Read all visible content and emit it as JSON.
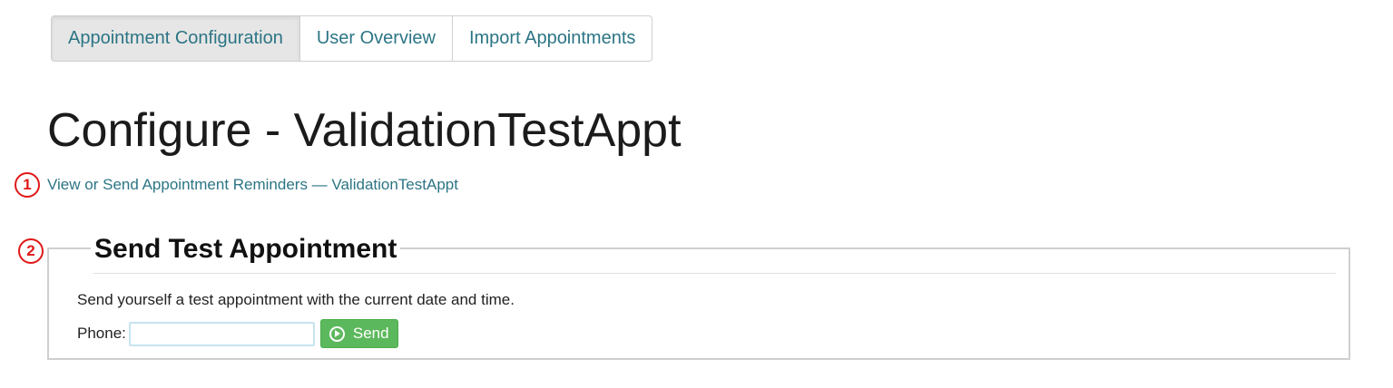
{
  "tabs": [
    {
      "label": "Appointment Configuration",
      "active": true
    },
    {
      "label": "User Overview",
      "active": false
    },
    {
      "label": "Import Appointments",
      "active": false
    }
  ],
  "page_title": "Configure - ValidationTestAppt",
  "markers": [
    "1",
    "2"
  ],
  "reminder_link": "View or Send Appointment Reminders — ValidationTestAppt",
  "send_test": {
    "legend": "Send Test Appointment",
    "description": "Send yourself a test appointment with the current date and time.",
    "phone_label": "Phone:",
    "phone_value": "",
    "send_label": "Send",
    "send_icon": "play-circle-icon"
  },
  "colors": {
    "link": "#2c7585",
    "button_green": "#5cb85c",
    "marker_red": "#e01818"
  }
}
